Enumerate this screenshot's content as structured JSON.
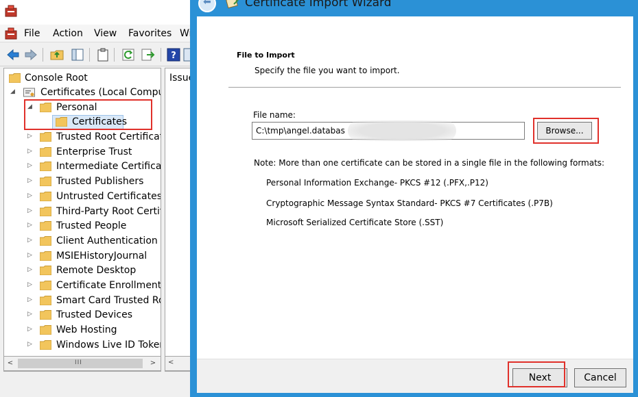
{
  "mmc": {
    "menu": [
      "File",
      "Action",
      "View",
      "Favorites",
      "Wi"
    ],
    "tree": {
      "root": "Console Root",
      "certificates_node": "Certificates (Local Computer)",
      "personal": "Personal",
      "personal_child": "Certificates",
      "stores": [
        "Trusted Root Certification Authorities",
        "Enterprise Trust",
        "Intermediate Certification Authorities",
        "Trusted Publishers",
        "Untrusted Certificates",
        "Third-Party Root Certification Authorities",
        "Trusted People",
        "Client Authentication Issuers",
        "MSIEHistoryJournal",
        "Remote Desktop",
        "Certificate Enrollment Requests",
        "Smart Card Trusted Roots",
        "Trusted Devices",
        "Web Hosting",
        "Windows Live ID Token Issuer"
      ]
    },
    "list_header": "Issued To",
    "scroll_grip": "III"
  },
  "wizard": {
    "title": "Certificate Import Wizard",
    "section_title": "File to Import",
    "section_subtitle": "Specify the file you want to import.",
    "file_name_label": "File name:",
    "file_name_value": "C:\\tmp\\angel.databas",
    "browse_label": "Browse...",
    "note": "Note:  More than one certificate can be stored in a single file in the following formats:",
    "formats": [
      "Personal Information Exchange- PKCS #12 (.PFX,.P12)",
      "Cryptographic Message Syntax Standard- PKCS #7 Certificates (.P7B)",
      "Microsoft Serialized Certificate Store (.SST)"
    ],
    "next_label": "Next",
    "cancel_label": "Cancel"
  },
  "colors": {
    "accent": "#2b91d6",
    "highlight": "#e0302a",
    "folder": "#f2c55c"
  },
  "icons": [
    "certificate-manager-icon",
    "back-arrow-icon",
    "forward-arrow-icon",
    "folder-icon",
    "help-icon",
    "certificate-wizard-icon"
  ]
}
